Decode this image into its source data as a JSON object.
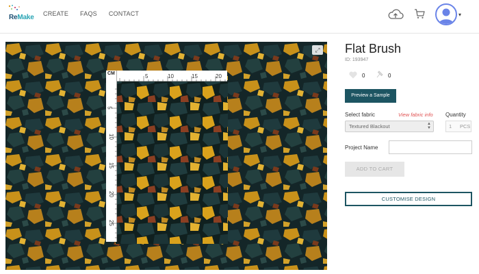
{
  "header": {
    "logo_text_prefix": "Re",
    "logo_text_suffix": "Make",
    "nav": [
      "CREATE",
      "FAQS",
      "CONTACT"
    ],
    "caret": "▾"
  },
  "image": {
    "expand_glyph": "⤢",
    "ruler_unit": "CM",
    "ruler_h_ticks": [
      "5",
      "10",
      "15",
      "20"
    ],
    "ruler_v_ticks": [
      "5",
      "10",
      "15",
      "20",
      "25"
    ]
  },
  "product": {
    "title": "Flat Brush",
    "id_text": "ID: 193947",
    "likes": "0",
    "pins": "0",
    "preview_label": "Preview a Sample",
    "select_fabric_label": "Select fabric",
    "fabric_info_link": "View fabric info",
    "quantity_label": "Quantity",
    "fabric_selected": "Textured Blackout",
    "quantity_value": "1",
    "quantity_unit": "PCS",
    "project_name_label": "Project Name",
    "project_name_value": "",
    "add_to_cart_label": "ADD TO CART",
    "customise_label": "CUSTOMISE DESIGN"
  },
  "colors": {
    "accent": "#1d5562",
    "link": "#e05050",
    "avatar_ring": "#6a84e8",
    "fabric_dark": "#15272a",
    "fabric_gold": "#d9a21c"
  },
  "icons": [
    "cloud-upload-icon",
    "cart-icon",
    "user-avatar-icon",
    "expand-icon",
    "heart-icon",
    "pin-icon"
  ]
}
